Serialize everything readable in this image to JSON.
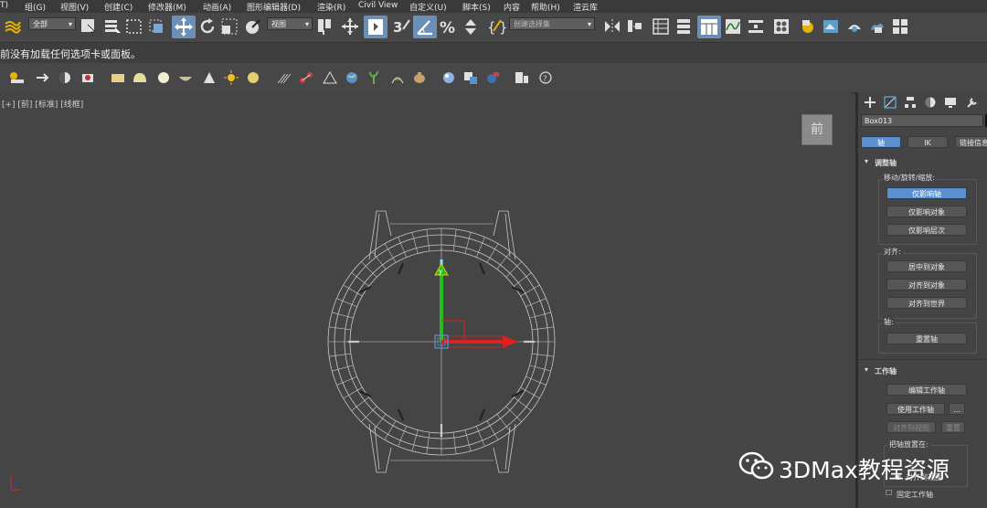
{
  "menu": {
    "items": [
      "T)",
      "组(G)",
      "视图(V)",
      "创建(C)",
      "修改器(M)",
      "动画(A)",
      "图形编辑器(D)",
      "渲染(R)",
      "Civil View",
      "自定义(U)",
      "脚本(S)",
      "内容",
      "帮助(H)",
      "渲云库"
    ]
  },
  "toolbar": {
    "selection_filter": "全部",
    "reference_coord": "视图",
    "named_selection_placeholder": "创建选择集"
  },
  "message": "前没有加载任何选项卡或面板。",
  "viewport": {
    "label": "[+] [前] [标准] [线框]",
    "viewcube_label": "前"
  },
  "panel": {
    "object_name": "Box013",
    "tabs": [
      "轴",
      "IK",
      "链接信息"
    ],
    "rollout_adjust_pivot": "调整轴",
    "group_move_rotate_scale": "移动/旋转/缩放:",
    "btn_affect_pivot_only": "仅影响轴",
    "btn_affect_object_only": "仅影响对象",
    "btn_affect_hierarchy_only": "仅影响层次",
    "group_alignment": "对齐:",
    "btn_center_to_object": "居中到对象",
    "btn_align_to_object": "对齐到对象",
    "btn_align_to_world": "对齐到世界",
    "group_pivot": "轴:",
    "btn_reset_pivot": "重置轴",
    "rollout_working_pivot": "工作轴",
    "btn_edit_working_pivot": "编辑工作轴",
    "btn_use_working_pivot": "使用工作轴",
    "btn_more": "...",
    "btn_align_to_view": "对齐到视图",
    "btn_reset": "重置",
    "group_place_pivot": "把轴放置在:",
    "radio_view": "对齐到视图",
    "checkbox_lock_working_pivot": "固定工作轴"
  },
  "watermark": {
    "text": "3DMax教程资源"
  },
  "colors": {
    "accent_blue": "#5b8fd0",
    "axis_x": "#e02020",
    "axis_y": "#20c020",
    "wireframe": "#c8c8c8"
  }
}
